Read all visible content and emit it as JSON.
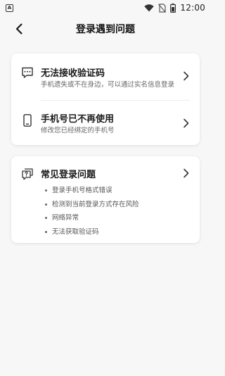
{
  "status_bar": {
    "app_icon_glyph": "A",
    "time": "12:00",
    "icons": [
      "wifi-icon",
      "no-sim-icon",
      "battery-icon"
    ]
  },
  "header": {
    "title": "登录遇到问题",
    "back_icon": "chevron-left-icon"
  },
  "problems": [
    {
      "icon": "message-dots-icon",
      "title": "无法接收验证码",
      "desc": "手机遗失或不在身边，可以通过实名信息登录"
    },
    {
      "icon": "phone-icon",
      "title": "手机号已不再使用",
      "desc": "修改您已经绑定的手机号"
    }
  ],
  "faq": {
    "icon": "question-bubble-icon",
    "title": "常见登录问题",
    "items": [
      "登录手机号格式错误",
      "检测到当前登录方式存在风险",
      "网络异常",
      "无法获取验证码"
    ]
  },
  "colors": {
    "background": "#f7f7f7",
    "card": "#ffffff",
    "text_primary": "#1a1a1a",
    "text_secondary": "#666666"
  }
}
